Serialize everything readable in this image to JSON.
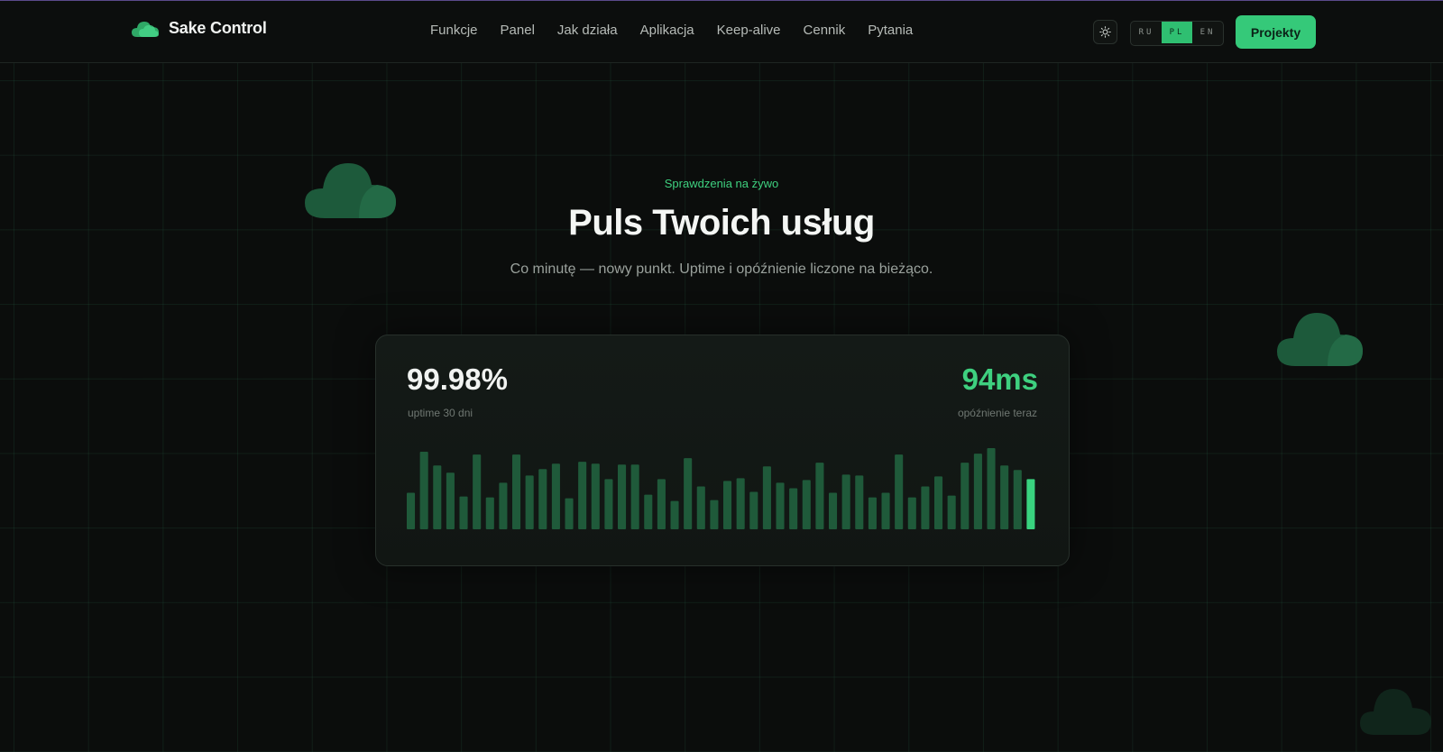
{
  "brand": {
    "name": "Sake Control",
    "logo_icon": "cloud-icon"
  },
  "nav": {
    "items": [
      "Funkcje",
      "Panel",
      "Jak działa",
      "Aplikacja",
      "Keep-alive",
      "Cennik",
      "Pytania"
    ]
  },
  "header": {
    "theme_icon": "sun-icon",
    "languages": [
      "RU",
      "PL",
      "EN"
    ],
    "active_language": "PL",
    "cta_label": "Projekty"
  },
  "hero": {
    "eyebrow": "Sprawdzenia na żywo",
    "title": "Puls Twoich usług",
    "subtitle": "Co minutę — nowy punkt. Uptime i opóźnienie liczone na bieżąco."
  },
  "stats": {
    "uptime_value": "99.98%",
    "uptime_label": "uptime 30 dni",
    "latency_value": "94ms",
    "latency_label": "opóźnienie teraz"
  },
  "colors": {
    "accent": "#35c979",
    "bar": "#1f5a3a",
    "bar_current": "#39d37f",
    "background": "#0b0d0c"
  },
  "chart_data": {
    "type": "bar",
    "values": [
      40,
      85,
      70,
      62,
      36,
      82,
      35,
      51,
      82,
      59,
      66,
      72,
      34,
      74,
      72,
      55,
      71,
      71,
      38,
      55,
      31,
      78,
      47,
      32,
      53,
      56,
      41,
      69,
      51,
      45,
      54,
      73,
      40,
      60,
      59,
      35,
      40,
      82,
      35,
      47,
      58,
      37,
      73,
      83,
      89,
      70,
      65,
      55
    ],
    "highlight_last": true
  }
}
